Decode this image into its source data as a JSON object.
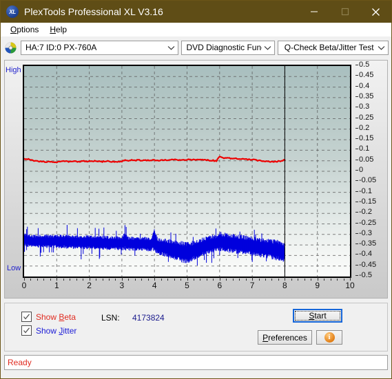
{
  "window": {
    "title": "PlexTools Professional XL V3.16",
    "app_icon": "xl-disc-icon",
    "minimize": "minimize-icon",
    "maximize": "maximize-icon",
    "close": "close-icon",
    "title_bar_color": "#5f4d16"
  },
  "menubar": {
    "items": [
      {
        "label": "Options",
        "accel": "O"
      },
      {
        "label": "Help",
        "accel": "H"
      }
    ]
  },
  "toolbar": {
    "drive_icon": "optical-disc-icon",
    "drive_combo": "HA:7 ID:0  PX-760A",
    "function_combo": "DVD Diagnostic Functions",
    "test_combo": "Q-Check Beta/Jitter Test"
  },
  "chart_labels": {
    "high": "High",
    "low": "Low"
  },
  "controls": {
    "show_beta": {
      "label": "Show Beta",
      "accel": "B",
      "checked": true,
      "color": "#e02b20"
    },
    "show_jitter": {
      "label": "Show Jitter",
      "accel": "J",
      "checked": true,
      "color": "#1a1ad6"
    },
    "lsn_label": "LSN:",
    "lsn_value": "4173824",
    "start_button": {
      "label": "Start",
      "accel": "S"
    },
    "preferences_button": {
      "label": "Preferences",
      "accel": "P"
    },
    "info_button": "info-icon"
  },
  "statusbar": {
    "text": "Ready",
    "color": "#e02b20"
  },
  "chart_data": {
    "type": "line",
    "title": "Q-Check Beta/Jitter Test",
    "xlabel": "",
    "ylabel": "",
    "xlim": [
      0,
      10
    ],
    "ylim": [
      -0.5,
      0.5
    ],
    "grid": true,
    "legend_position": "external-checkboxes",
    "xticks": [
      0,
      1,
      2,
      3,
      4,
      5,
      6,
      7,
      8,
      9,
      10
    ],
    "yticks": [
      0.5,
      0.45,
      0.4,
      0.35,
      0.3,
      0.25,
      0.2,
      0.15,
      0.1,
      0.05,
      0,
      -0.05,
      -0.1,
      -0.15,
      -0.2,
      -0.25,
      -0.3,
      -0.35,
      -0.4,
      -0.45,
      -0.5
    ],
    "ytick_labels": [
      "0.5",
      "0.45",
      "0.4",
      "0.35",
      "0.3",
      "0.25",
      "0.2",
      "0.15",
      "0.1",
      "0.05",
      "0",
      "-0.05",
      "-0.1",
      "-0.15",
      "-0.2",
      "-0.25",
      "-0.3",
      "-0.35",
      "-0.4",
      "-0.45",
      "-0.5"
    ],
    "data_end_x": 8,
    "marker_line_x": 8,
    "series": [
      {
        "name": "Beta",
        "color": "#ee0000",
        "x": [
          0.0,
          0.1,
          0.2,
          0.3,
          0.4,
          0.5,
          0.6,
          0.7,
          0.8,
          0.9,
          1.0,
          1.1,
          1.2,
          1.3,
          1.4,
          1.5,
          1.6,
          1.7,
          1.8,
          1.9,
          2.0,
          2.1,
          2.2,
          2.3,
          2.4,
          2.5,
          2.6,
          2.7,
          2.8,
          2.9,
          3.0,
          3.1,
          3.2,
          3.3,
          3.4,
          3.5,
          3.6,
          3.7,
          3.8,
          3.9,
          4.0,
          4.1,
          4.2,
          4.3,
          4.4,
          4.5,
          4.6,
          4.7,
          4.8,
          4.9,
          5.0,
          5.1,
          5.2,
          5.3,
          5.4,
          5.5,
          5.6,
          5.7,
          5.8,
          5.9,
          6.0,
          6.1,
          6.2,
          6.3,
          6.4,
          6.5,
          6.6,
          6.7,
          6.8,
          6.9,
          7.0,
          7.1,
          7.2,
          7.3,
          7.4,
          7.5,
          7.6,
          7.7,
          7.8,
          7.9,
          8.0
        ],
        "y": [
          0.06,
          0.058,
          0.055,
          0.051,
          0.048,
          0.046,
          0.045,
          0.044,
          0.044,
          0.043,
          0.043,
          0.048,
          0.047,
          0.046,
          0.046,
          0.045,
          0.047,
          0.046,
          0.048,
          0.047,
          0.048,
          0.046,
          0.049,
          0.047,
          0.046,
          0.049,
          0.047,
          0.045,
          0.047,
          0.044,
          0.047,
          0.052,
          0.051,
          0.053,
          0.051,
          0.053,
          0.052,
          0.053,
          0.052,
          0.053,
          0.053,
          0.052,
          0.053,
          0.054,
          0.053,
          0.054,
          0.055,
          0.054,
          0.055,
          0.055,
          0.056,
          0.056,
          0.055,
          0.057,
          0.056,
          0.054,
          0.053,
          0.052,
          0.051,
          0.049,
          0.068,
          0.064,
          0.063,
          0.062,
          0.061,
          0.06,
          0.059,
          0.058,
          0.057,
          0.056,
          0.055,
          0.053,
          0.051,
          0.049,
          0.048,
          0.047,
          0.046,
          0.046,
          0.047,
          0.05,
          0.056
        ]
      },
      {
        "name": "Jitter",
        "color": "#0000dd",
        "description": "Dense noise band drawn as vertical min/max envelope",
        "x": [
          0.0,
          0.1,
          0.2,
          0.3,
          0.4,
          0.5,
          0.6,
          0.7,
          0.8,
          0.9,
          1.0,
          1.1,
          1.2,
          1.3,
          1.4,
          1.5,
          1.6,
          1.7,
          1.8,
          1.9,
          2.0,
          2.1,
          2.2,
          2.3,
          2.4,
          2.5,
          2.6,
          2.7,
          2.8,
          2.9,
          3.0,
          3.1,
          3.2,
          3.3,
          3.4,
          3.5,
          3.6,
          3.7,
          3.8,
          3.9,
          4.0,
          4.1,
          4.2,
          4.3,
          4.4,
          4.5,
          4.6,
          4.7,
          4.8,
          4.9,
          5.0,
          5.1,
          5.2,
          5.3,
          5.4,
          5.5,
          5.6,
          5.7,
          5.8,
          5.9,
          6.0,
          6.1,
          6.2,
          6.3,
          6.4,
          6.5,
          6.6,
          6.7,
          6.8,
          6.9,
          7.0,
          7.1,
          7.2,
          7.3,
          7.4,
          7.5,
          7.6,
          7.7,
          7.8,
          7.9,
          8.0
        ],
        "y_max": [
          -0.295,
          -0.3,
          -0.3,
          -0.302,
          -0.3,
          -0.303,
          -0.302,
          -0.3,
          -0.302,
          -0.303,
          -0.3,
          -0.302,
          -0.303,
          -0.3,
          -0.304,
          -0.303,
          -0.302,
          -0.305,
          -0.304,
          -0.303,
          -0.305,
          -0.306,
          -0.305,
          -0.307,
          -0.306,
          -0.308,
          -0.307,
          -0.309,
          -0.308,
          -0.31,
          -0.309,
          -0.288,
          -0.31,
          -0.311,
          -0.31,
          -0.312,
          -0.311,
          -0.313,
          -0.312,
          -0.314,
          -0.268,
          -0.316,
          -0.318,
          -0.32,
          -0.322,
          -0.325,
          -0.327,
          -0.33,
          -0.332,
          -0.335,
          -0.335,
          -0.334,
          -0.33,
          -0.326,
          -0.32,
          -0.315,
          -0.31,
          -0.306,
          -0.302,
          -0.3,
          -0.285,
          -0.292,
          -0.294,
          -0.296,
          -0.298,
          -0.3,
          -0.302,
          -0.304,
          -0.306,
          -0.308,
          -0.31,
          -0.312,
          -0.314,
          -0.316,
          -0.318,
          -0.32,
          -0.322,
          -0.325,
          -0.328,
          -0.332,
          -0.338
        ],
        "y_min": [
          -0.352,
          -0.358,
          -0.36,
          -0.362,
          -0.361,
          -0.363,
          -0.362,
          -0.364,
          -0.363,
          -0.365,
          -0.364,
          -0.366,
          -0.365,
          -0.367,
          -0.366,
          -0.368,
          -0.367,
          -0.369,
          -0.37,
          -0.369,
          -0.371,
          -0.37,
          -0.372,
          -0.371,
          -0.373,
          -0.372,
          -0.374,
          -0.373,
          -0.375,
          -0.374,
          -0.376,
          -0.375,
          -0.377,
          -0.376,
          -0.378,
          -0.377,
          -0.379,
          -0.378,
          -0.38,
          -0.379,
          -0.381,
          -0.395,
          -0.4,
          -0.404,
          -0.408,
          -0.412,
          -0.418,
          -0.424,
          -0.43,
          -0.436,
          -0.438,
          -0.43,
          -0.422,
          -0.414,
          -0.406,
          -0.4,
          -0.394,
          -0.39,
          -0.386,
          -0.382,
          -0.38,
          -0.382,
          -0.384,
          -0.386,
          -0.388,
          -0.39,
          -0.392,
          -0.394,
          -0.397,
          -0.4,
          -0.402,
          -0.404,
          -0.406,
          -0.409,
          -0.412,
          -0.415,
          -0.418,
          -0.421,
          -0.424,
          -0.428,
          -0.432
        ]
      }
    ]
  }
}
